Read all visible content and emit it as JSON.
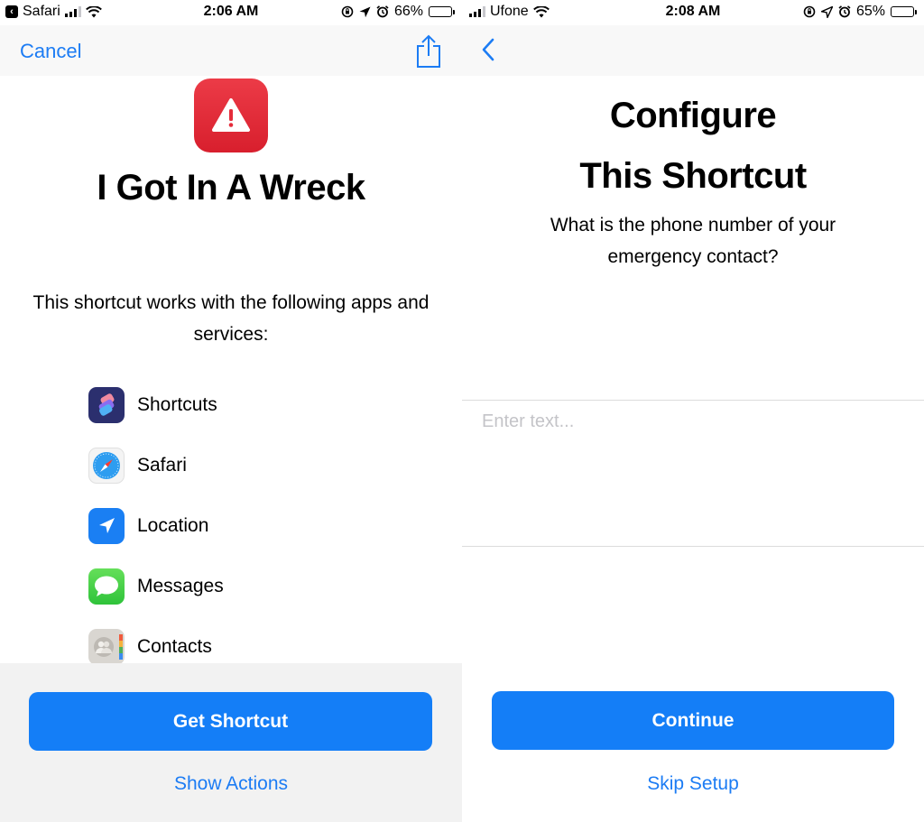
{
  "left_screen": {
    "status_bar": {
      "back_app": "Safari",
      "time": "2:06 AM",
      "battery_percent": "66%",
      "battery_level": 0.66
    },
    "nav": {
      "cancel_label": "Cancel",
      "share_icon": "share-icon"
    },
    "shortcut": {
      "title": "I Got In A Wreck",
      "icon": "warning-icon",
      "icon_color": "#e52c3a",
      "works_with_text": "This shortcut works with the following apps and services:",
      "apps": [
        {
          "label": "Shortcuts",
          "icon": "shortcuts-app-icon"
        },
        {
          "label": "Safari",
          "icon": "safari-app-icon"
        },
        {
          "label": "Location",
          "icon": "location-app-icon"
        },
        {
          "label": "Messages",
          "icon": "messages-app-icon"
        },
        {
          "label": "Contacts",
          "icon": "contacts-app-icon"
        }
      ]
    },
    "actions": {
      "primary_label": "Get Shortcut",
      "secondary_label": "Show Actions"
    }
  },
  "right_screen": {
    "status_bar": {
      "carrier": "Ufone",
      "time": "2:08 AM",
      "battery_percent": "65%",
      "battery_level": 0.65
    },
    "nav": {
      "back_icon": "chevron-left-icon"
    },
    "configure": {
      "title_line1": "Configure",
      "title_line2": "This Shortcut",
      "question": "What is the phone number of your emergency contact?",
      "input_placeholder": "Enter text...",
      "input_value": ""
    },
    "actions": {
      "primary_label": "Continue",
      "secondary_label": "Skip Setup"
    }
  },
  "colors": {
    "accent": "#147ef7",
    "link": "#1c7cf4"
  }
}
